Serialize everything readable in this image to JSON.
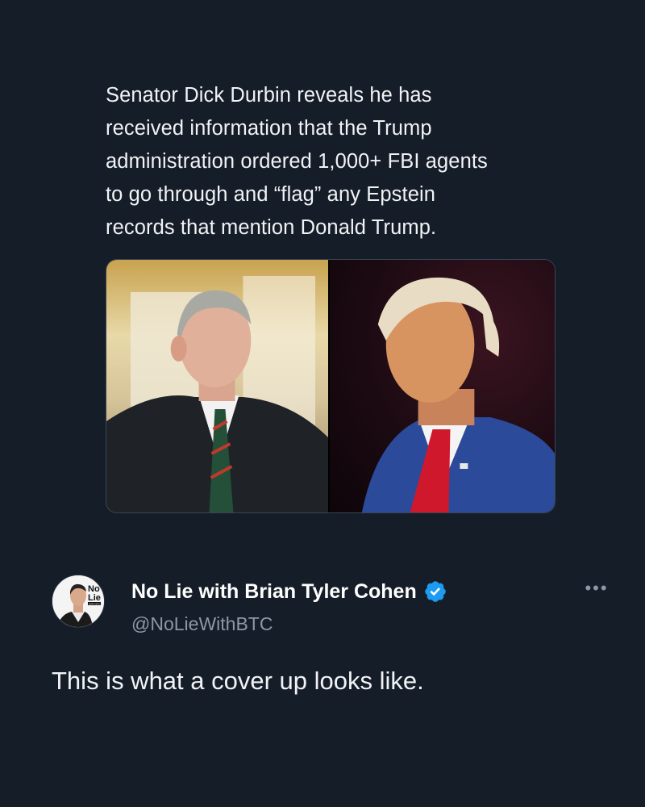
{
  "quoted_post": {
    "text_lines": [
      "Senator Dick Durbin reveals he has",
      "received information that the Trump",
      "administration ordered 1,000+ FBI agents",
      "to go through and “flag” any Epstein",
      "records that mention Donald Trump."
    ]
  },
  "author": {
    "display_name": "No Lie with Brian Tyler Cohen",
    "handle": "@NoLieWithBTC",
    "verified": true,
    "avatar_text": [
      "No",
      "Lie"
    ],
    "avatar_small_text": "WITH BTC"
  },
  "post": {
    "text": "This is what a cover up looks like."
  },
  "menu": {
    "more_label": "•••"
  },
  "colors": {
    "background": "#151d28",
    "verified_badge": "#1d9bf0",
    "secondary_text": "#8b98a5"
  }
}
